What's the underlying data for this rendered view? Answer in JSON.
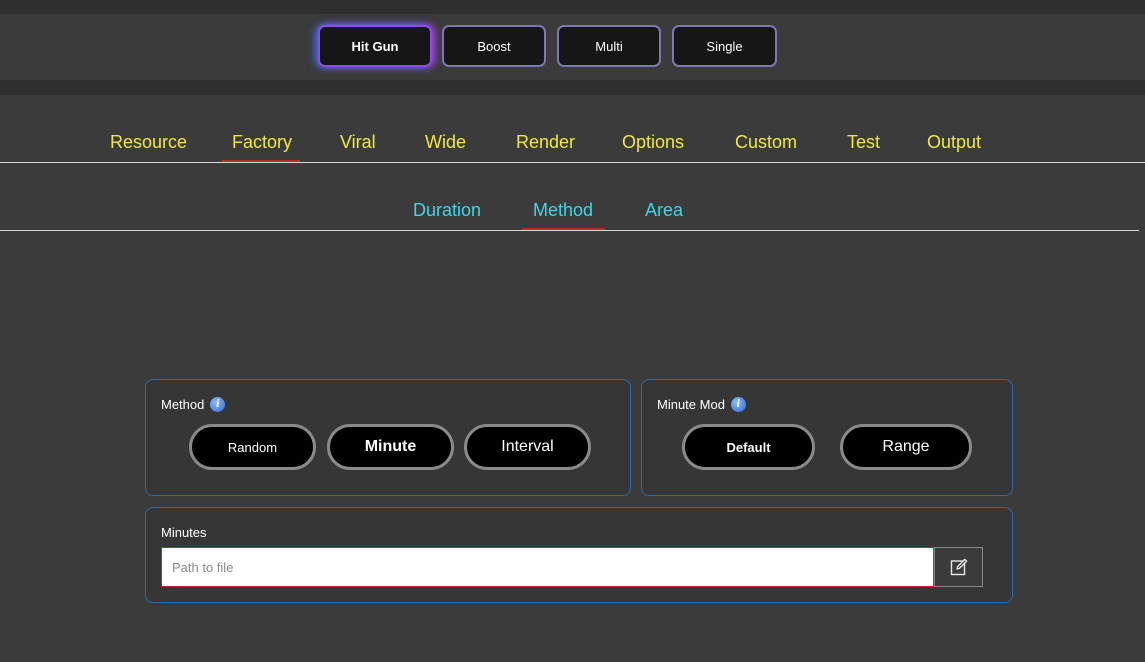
{
  "mode_buttons": [
    {
      "label": "Hit Gun",
      "active": true
    },
    {
      "label": "Boost",
      "active": false
    },
    {
      "label": "Multi",
      "active": false
    },
    {
      "label": "Single",
      "active": false
    }
  ],
  "main_tabs": [
    {
      "label": "Resource"
    },
    {
      "label": "Factory",
      "active": true
    },
    {
      "label": "Viral"
    },
    {
      "label": "Wide"
    },
    {
      "label": "Render"
    },
    {
      "label": "Options"
    },
    {
      "label": "Custom"
    },
    {
      "label": "Test"
    },
    {
      "label": "Output"
    }
  ],
  "sub_tabs": [
    {
      "label": "Duration"
    },
    {
      "label": "Method",
      "active": true
    },
    {
      "label": "Area"
    }
  ],
  "method_panel": {
    "label": "Method",
    "options": [
      "Random",
      "Minute",
      "Interval"
    ],
    "selected": "Minute"
  },
  "minute_mod_panel": {
    "label": "Minute Mod",
    "options": [
      "Default",
      "Range"
    ],
    "selected": "Default"
  },
  "minutes_panel": {
    "label": "Minutes",
    "input_value": "",
    "input_placeholder": "Path to file"
  },
  "colors": {
    "background": "#3b3b3b",
    "tab_text": "#f0e93a",
    "subtab_text": "#3ad8e8",
    "active_underline": "#c0262c",
    "panel_border": "#2a6aa8"
  },
  "icons": {
    "info": "info-icon",
    "edit": "edit-icon"
  }
}
